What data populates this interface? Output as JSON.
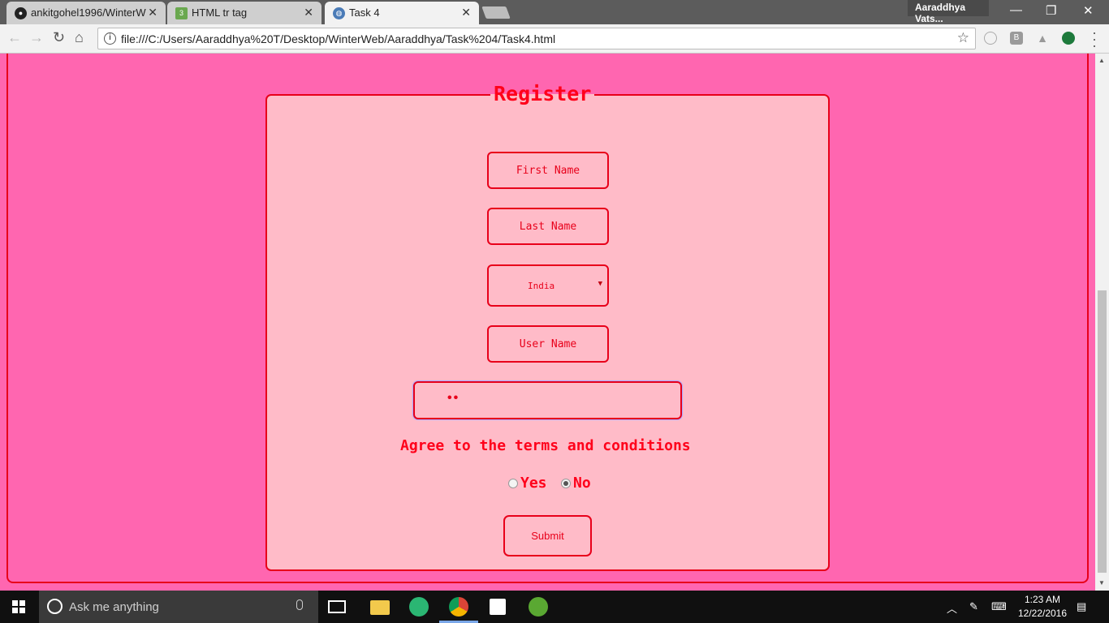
{
  "browser": {
    "tabs": [
      {
        "label": "ankitgohel1996/WinterW",
        "active": false
      },
      {
        "label": "HTML tr tag",
        "active": false
      },
      {
        "label": "Task 4",
        "active": true
      }
    ],
    "profile_name": "Aaraddhya Vats...",
    "url": "file:///C:/Users/Aaraddhya%20T/Desktop/WinterWeb/Aaraddhya/Task%204/Task4.html",
    "extension_b_label": "B"
  },
  "form": {
    "legend": "Register",
    "first_name_placeholder": "First Name",
    "last_name_placeholder": "Last Name",
    "country_selected": "India",
    "username_placeholder": "User Name",
    "password_masked": "••",
    "terms_label": "Agree to the terms and conditions",
    "radio_yes_label": "Yes",
    "radio_no_label": "No",
    "selected_option": "No",
    "submit_label": "Submit"
  },
  "taskbar": {
    "search_placeholder": "Ask me anything",
    "time": "1:23 AM",
    "date": "12/22/2016"
  },
  "colors": {
    "page_background": "#ff66b0",
    "form_background": "#ffbbc8",
    "accent_red": "#ff001a"
  }
}
